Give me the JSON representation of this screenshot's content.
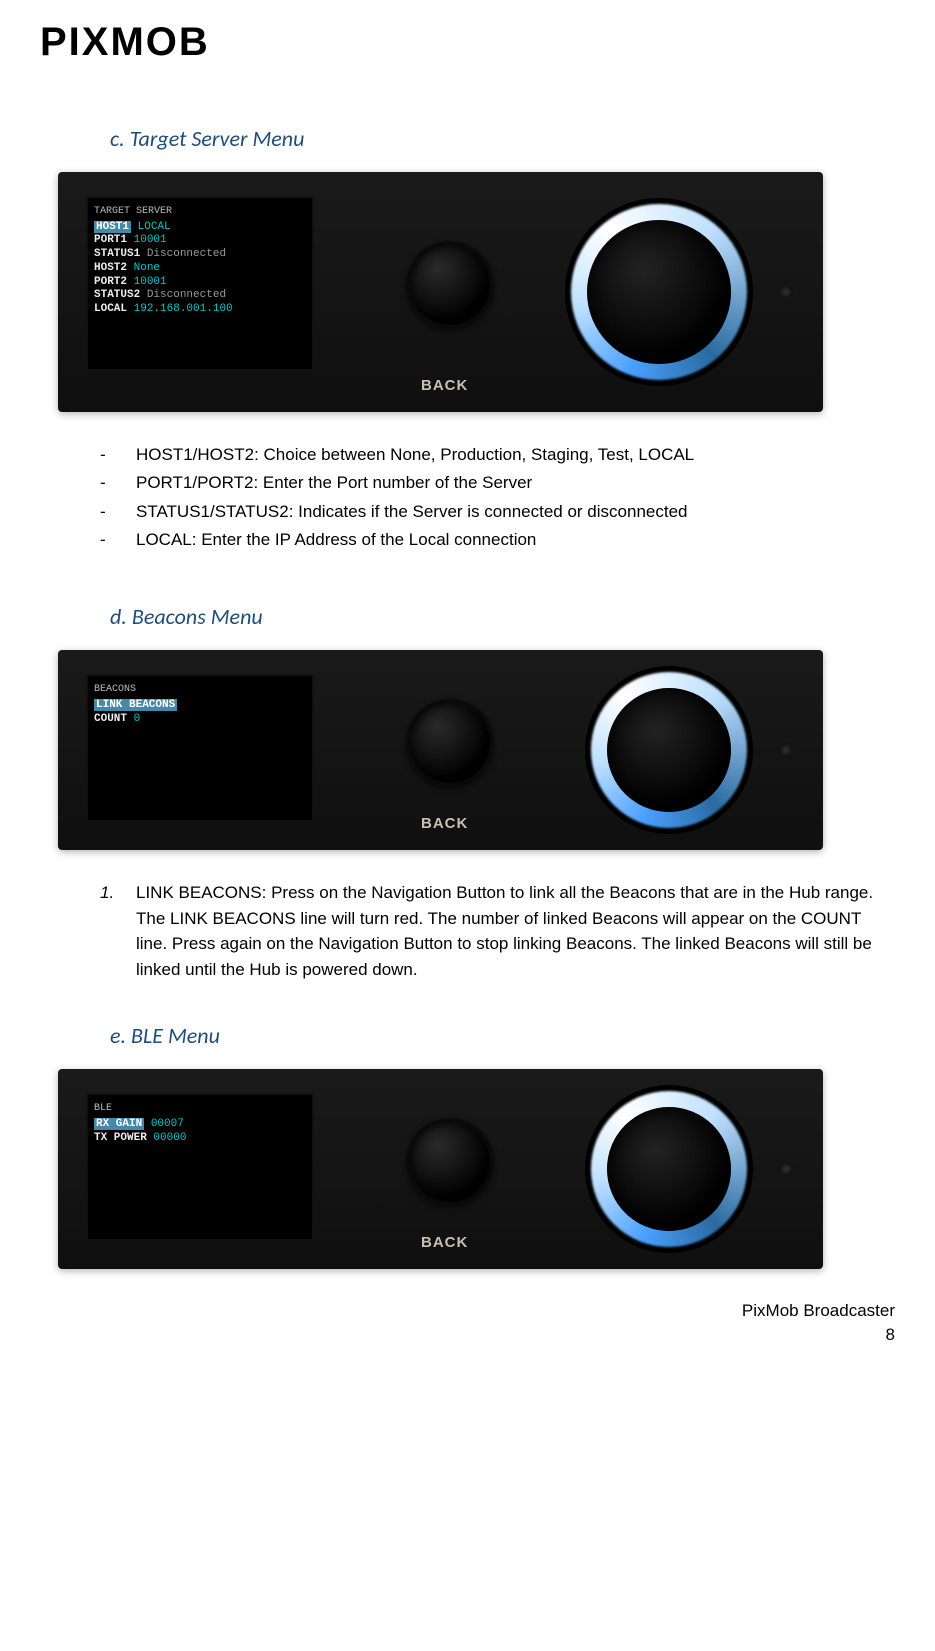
{
  "header": {
    "logo": "PIXMOB"
  },
  "section_c": {
    "letter": "c.",
    "title": "Target Server Menu",
    "screen": {
      "title": "TARGET SERVER",
      "rows": [
        {
          "label": "HOST1",
          "value": "LOCAL",
          "highlight": true,
          "vclass": "val"
        },
        {
          "label": "PORT1",
          "value": "10001",
          "highlight": false,
          "vclass": "val"
        },
        {
          "label": "STATUS1",
          "value": "Disconnected",
          "highlight": false,
          "vclass": "val2"
        },
        {
          "label": "HOST2",
          "value": "None",
          "highlight": false,
          "vclass": "val"
        },
        {
          "label": "PORT2",
          "value": "10001",
          "highlight": false,
          "vclass": "val"
        },
        {
          "label": "STATUS2",
          "value": "Disconnected",
          "highlight": false,
          "vclass": "val2"
        },
        {
          "label": "LOCAL",
          "value": "192.168.001.100",
          "highlight": false,
          "vclass": "val"
        }
      ]
    },
    "back": "BACK",
    "bullets": [
      "HOST1/HOST2: Choice between None, Production, Staging, Test, LOCAL",
      "PORT1/PORT2: Enter the Port number of the Server",
      "STATUS1/STATUS2: Indicates if the Server is connected or disconnected",
      "LOCAL: Enter the IP Address of the Local connection"
    ]
  },
  "section_d": {
    "letter": "d.",
    "title": "Beacons Menu",
    "screen": {
      "title": "BEACONS",
      "rows": [
        {
          "label": "LINK BEACONS",
          "value": "",
          "highlight": true,
          "vclass": "val"
        },
        {
          "label": "COUNT",
          "value": "0",
          "highlight": false,
          "vclass": "val"
        }
      ]
    },
    "back": "BACK",
    "numbered": [
      {
        "n": "1.",
        "text": "LINK BEACONS: Press on the Navigation Button to link all the Beacons that are in the Hub range. The LINK BEACONS line will turn red. The number of linked Beacons will appear on the COUNT line. Press again on the Navigation Button to stop linking Beacons. The linked Beacons will still be linked until the Hub is powered down."
      }
    ]
  },
  "section_e": {
    "letter": "e.",
    "title": "BLE Menu",
    "screen": {
      "title": "BLE",
      "rows": [
        {
          "label": "RX GAIN",
          "value": "00007",
          "highlight": true,
          "vclass": "val"
        },
        {
          "label": "TX POWER",
          "value": "00000",
          "highlight": false,
          "vclass": "val"
        }
      ]
    },
    "back": "BACK"
  },
  "footer": {
    "doc": "PixMob Broadcaster",
    "page": "8"
  }
}
